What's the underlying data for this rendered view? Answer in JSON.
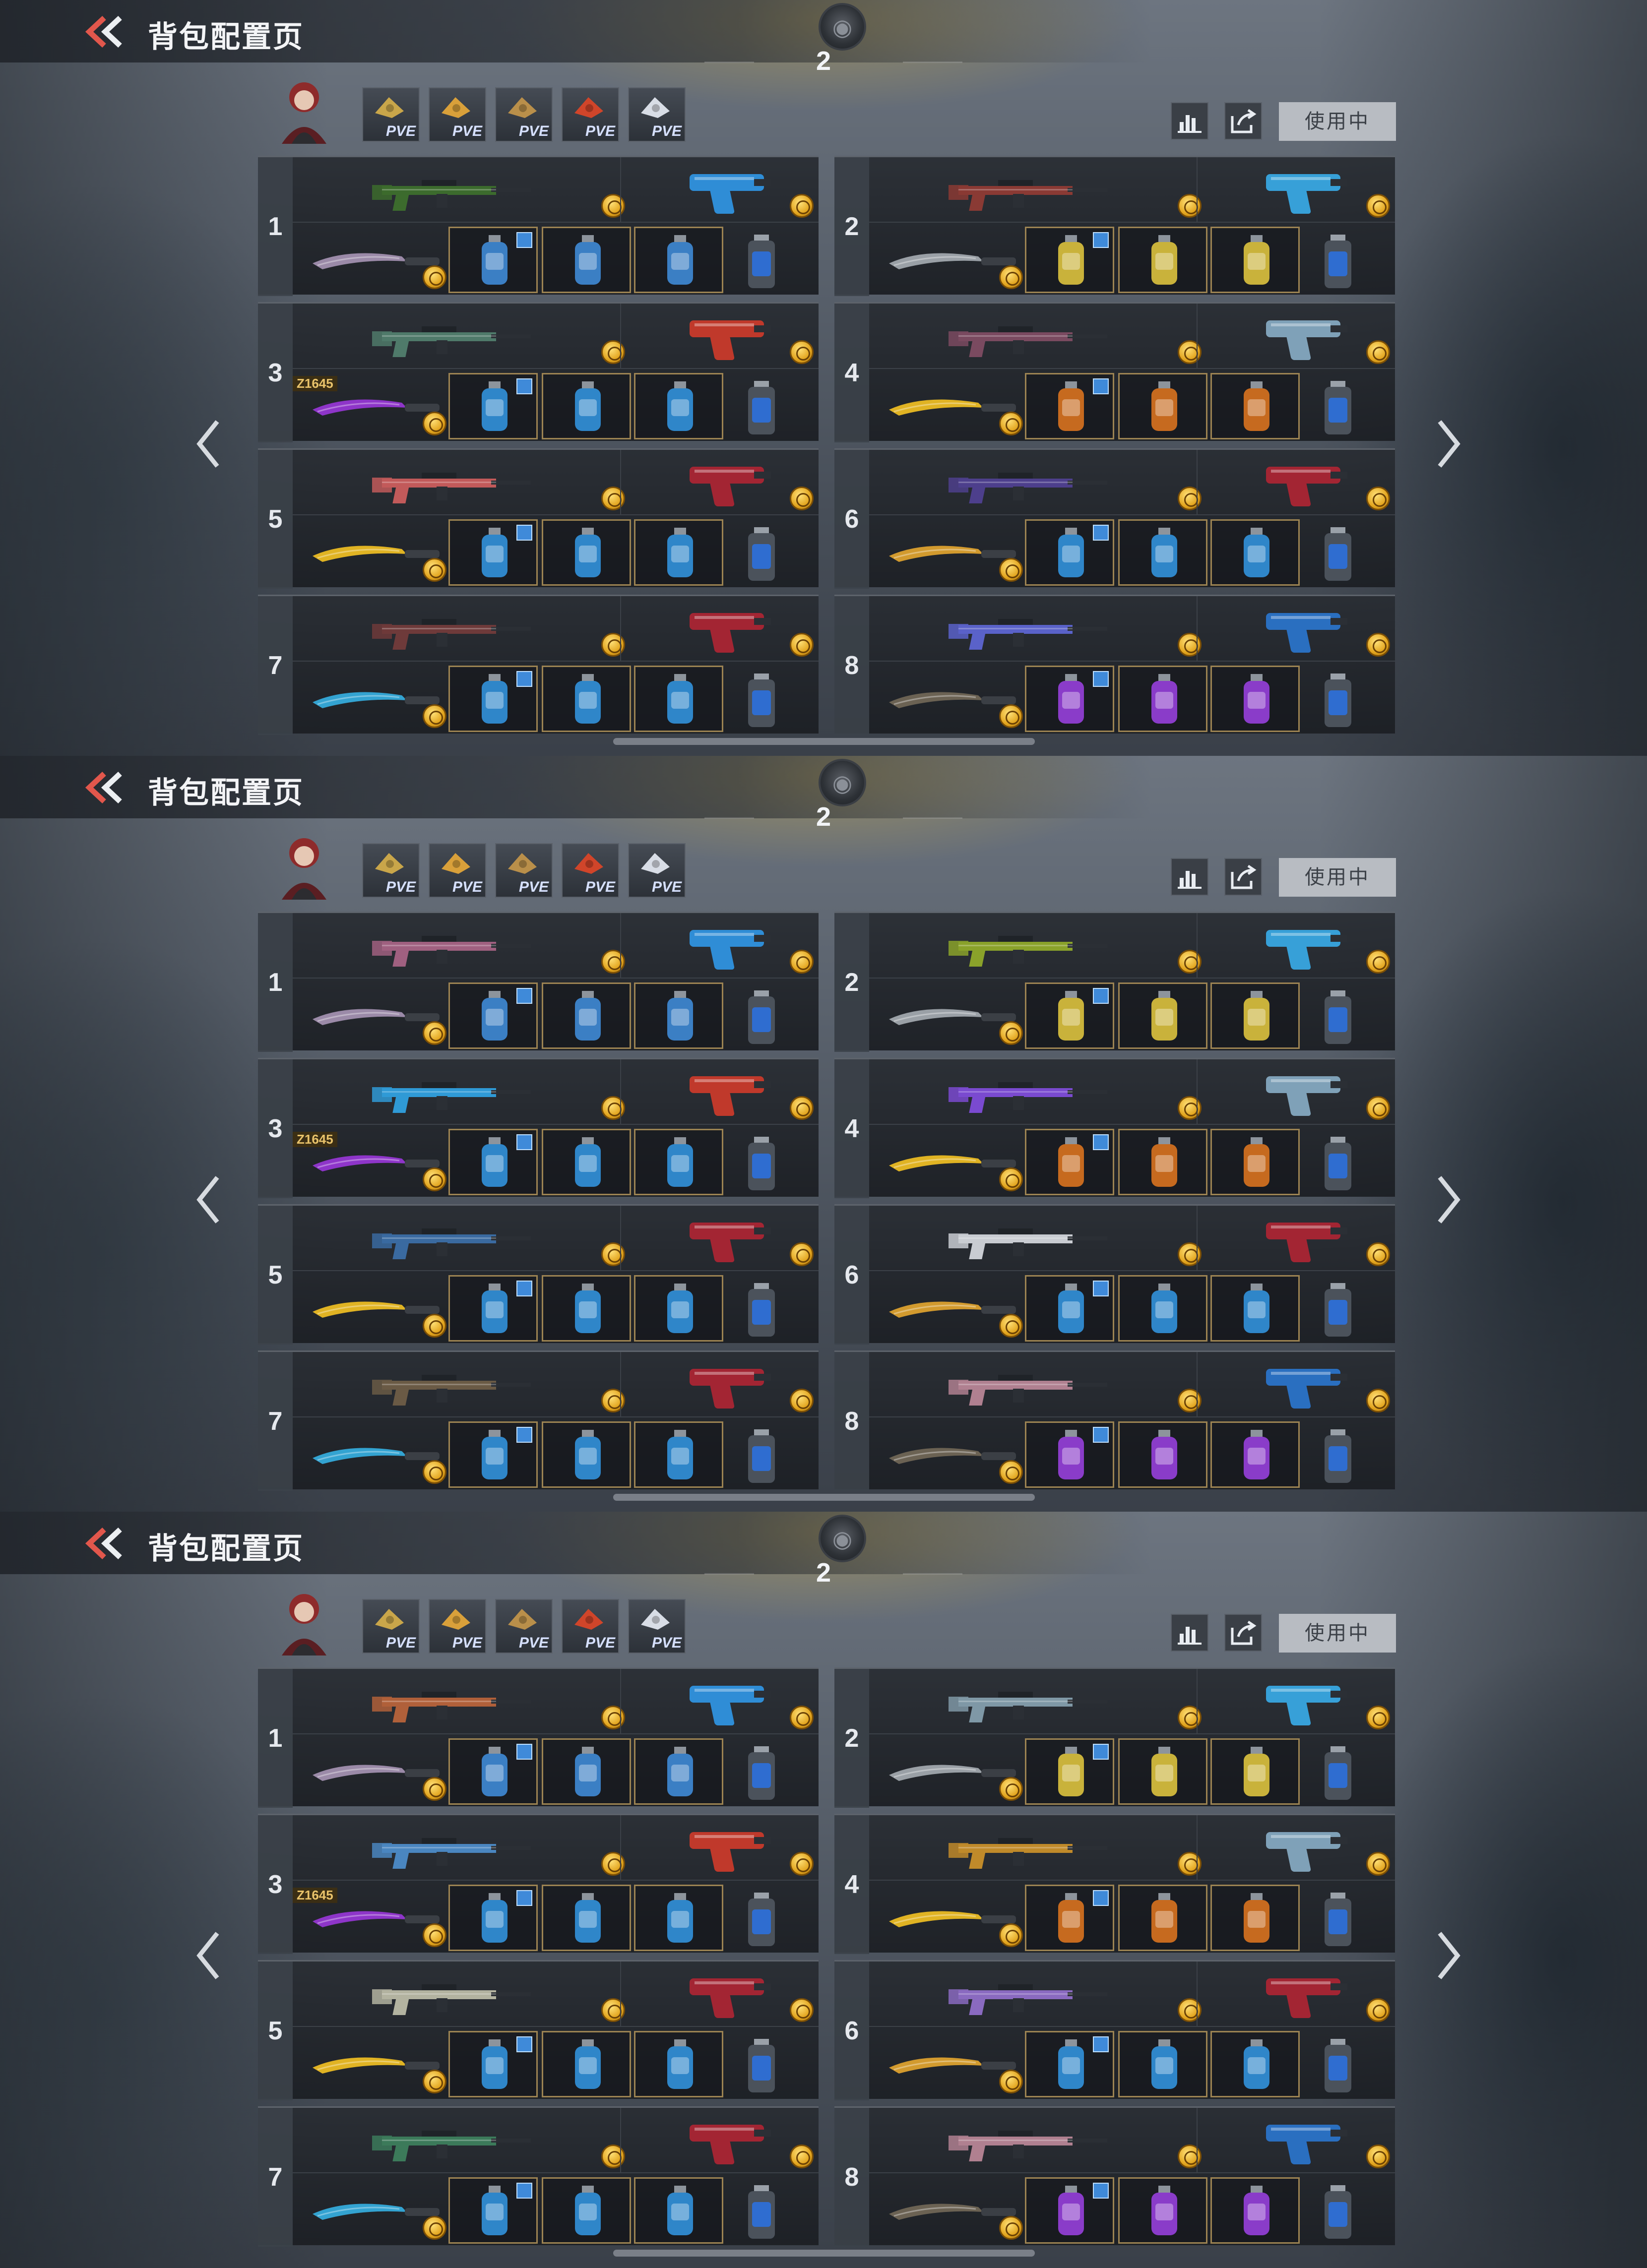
{
  "screens": [
    {
      "title": "背包配置页",
      "loadout_number": "2",
      "in_use_label": "使用中",
      "perks": [
        "PVE",
        "PVE",
        "PVE",
        "PVE",
        "PVE"
      ],
      "loadouts": [
        {
          "number": "1",
          "primary_color": "#3c6b2d",
          "secondary_color": "#2f8dd6",
          "knife_color": "#9b8aa8",
          "grenade_color": "#3b7fc4",
          "knife_tag": ""
        },
        {
          "number": "2",
          "primary_color": "#8a3a34",
          "secondary_color": "#37a0d8",
          "knife_color": "#9aa0a6",
          "grenade_color": "#c9b23b",
          "knife_tag": ""
        },
        {
          "number": "3",
          "primary_color": "#4f7a6a",
          "secondary_color": "#c0392b",
          "knife_color": "#8e35c9",
          "grenade_color": "#2f86c9",
          "knife_tag": "Z1645"
        },
        {
          "number": "4",
          "primary_color": "#7a4a60",
          "secondary_color": "#7fa1b8",
          "knife_color": "#e0b323",
          "grenade_color": "#c66a1f",
          "knife_tag": ""
        },
        {
          "number": "5",
          "primary_color": "#c25a5a",
          "secondary_color": "#a32533",
          "knife_color": "#e0b323",
          "grenade_color": "#2f86c9",
          "knife_tag": ""
        },
        {
          "number": "6",
          "primary_color": "#4d3f8c",
          "secondary_color": "#a32533",
          "knife_color": "#d29a2e",
          "grenade_color": "#2f86c9",
          "knife_tag": ""
        },
        {
          "number": "7",
          "primary_color": "#6e3a3a",
          "secondary_color": "#a32533",
          "knife_color": "#33a3d1",
          "grenade_color": "#2f86c9",
          "knife_tag": ""
        },
        {
          "number": "8",
          "primary_color": "#5a62c9",
          "secondary_color": "#2a6fc0",
          "knife_color": "#6b6253",
          "grenade_color": "#8a3cc9",
          "knife_tag": ""
        }
      ]
    },
    {
      "title": "背包配置页",
      "loadout_number": "2",
      "in_use_label": "使用中",
      "perks": [
        "PVE",
        "PVE",
        "PVE",
        "PVE",
        "PVE"
      ],
      "loadouts": [
        {
          "number": "1",
          "primary_color": "#a06080",
          "secondary_color": "#2f8dd6",
          "knife_color": "#9b8aa8",
          "grenade_color": "#3b7fc4",
          "knife_tag": ""
        },
        {
          "number": "2",
          "primary_color": "#8aa22a",
          "secondary_color": "#37a0d8",
          "knife_color": "#9aa0a6",
          "grenade_color": "#c9b23b",
          "knife_tag": ""
        },
        {
          "number": "3",
          "primary_color": "#2f9ad6",
          "secondary_color": "#c0392b",
          "knife_color": "#8e35c9",
          "grenade_color": "#2f86c9",
          "knife_tag": "Z1645"
        },
        {
          "number": "4",
          "primary_color": "#7a4ad0",
          "secondary_color": "#7fa1b8",
          "knife_color": "#e0b323",
          "grenade_color": "#c66a1f",
          "knife_tag": ""
        },
        {
          "number": "5",
          "primary_color": "#3a6aa0",
          "secondary_color": "#a32533",
          "knife_color": "#e0b323",
          "grenade_color": "#2f86c9",
          "knife_tag": ""
        },
        {
          "number": "6",
          "primary_color": "#c9ccd2",
          "secondary_color": "#a32533",
          "knife_color": "#d29a2e",
          "grenade_color": "#2f86c9",
          "knife_tag": ""
        },
        {
          "number": "7",
          "primary_color": "#6a5a45",
          "secondary_color": "#a32533",
          "knife_color": "#33a3d1",
          "grenade_color": "#2f86c9",
          "knife_tag": ""
        },
        {
          "number": "8",
          "primary_color": "#b08090",
          "secondary_color": "#2a6fc0",
          "knife_color": "#6b6253",
          "grenade_color": "#8a3cc9",
          "knife_tag": ""
        }
      ]
    },
    {
      "title": "背包配置页",
      "loadout_number": "2",
      "in_use_label": "使用中",
      "perks": [
        "PVE",
        "PVE",
        "PVE",
        "PVE",
        "PVE"
      ],
      "loadouts": [
        {
          "number": "1",
          "primary_color": "#b0603a",
          "secondary_color": "#2f8dd6",
          "knife_color": "#9b8aa8",
          "grenade_color": "#3b7fc4",
          "knife_tag": ""
        },
        {
          "number": "2",
          "primary_color": "#7f98a6",
          "secondary_color": "#37a0d8",
          "knife_color": "#9aa0a6",
          "grenade_color": "#c9b23b",
          "knife_tag": ""
        },
        {
          "number": "3",
          "primary_color": "#4a86c0",
          "secondary_color": "#c0392b",
          "knife_color": "#8e35c9",
          "grenade_color": "#2f86c9",
          "knife_tag": "Z1645"
        },
        {
          "number": "4",
          "primary_color": "#c08a2a",
          "secondary_color": "#7fa1b8",
          "knife_color": "#e0b323",
          "grenade_color": "#c66a1f",
          "knife_tag": ""
        },
        {
          "number": "5",
          "primary_color": "#b3b3a0",
          "secondary_color": "#a32533",
          "knife_color": "#e0b323",
          "grenade_color": "#2f86c9",
          "knife_tag": ""
        },
        {
          "number": "6",
          "primary_color": "#8a6ac0",
          "secondary_color": "#a32533",
          "knife_color": "#d29a2e",
          "grenade_color": "#2f86c9",
          "knife_tag": ""
        },
        {
          "number": "7",
          "primary_color": "#3c7a5a",
          "secondary_color": "#a32533",
          "knife_color": "#33a3d1",
          "grenade_color": "#2f86c9",
          "knife_tag": ""
        },
        {
          "number": "8",
          "primary_color": "#b08090",
          "secondary_color": "#2a6fc0",
          "knife_color": "#6b6253",
          "grenade_color": "#8a3cc9",
          "knife_tag": ""
        }
      ]
    }
  ],
  "icons": {
    "back": "double-chevron-left-icon",
    "stats": "bar-chart-icon",
    "share": "share-icon",
    "prev": "chevron-left-icon",
    "next": "chevron-right-icon"
  },
  "colors": {
    "accent_red": "#e2574c",
    "gold": "#e2a41d",
    "slot_border": "#9c8352",
    "button_gray": "#b8bcc2"
  }
}
